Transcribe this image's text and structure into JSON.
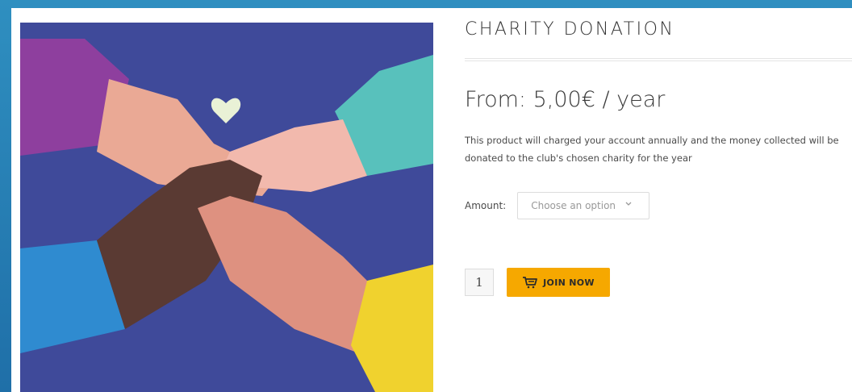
{
  "product": {
    "title": "CHARITY DONATION",
    "price": "From: 5,00€ / year",
    "description": "This product will charged your account annually and the money collected will be donated to the club's chosen charity for the year",
    "amount_label": "Amount:",
    "amount_select": {
      "value": "Choose an option"
    },
    "quantity": "1",
    "join_label": "JOIN NOW"
  },
  "icons": {
    "cart": "cart-icon",
    "select": "chevron-down-icon",
    "heart": "heart-icon"
  },
  "colors": {
    "accent": "#f6a800",
    "image_background": "#3f4a9a",
    "page_background": "#2f8fc0"
  }
}
